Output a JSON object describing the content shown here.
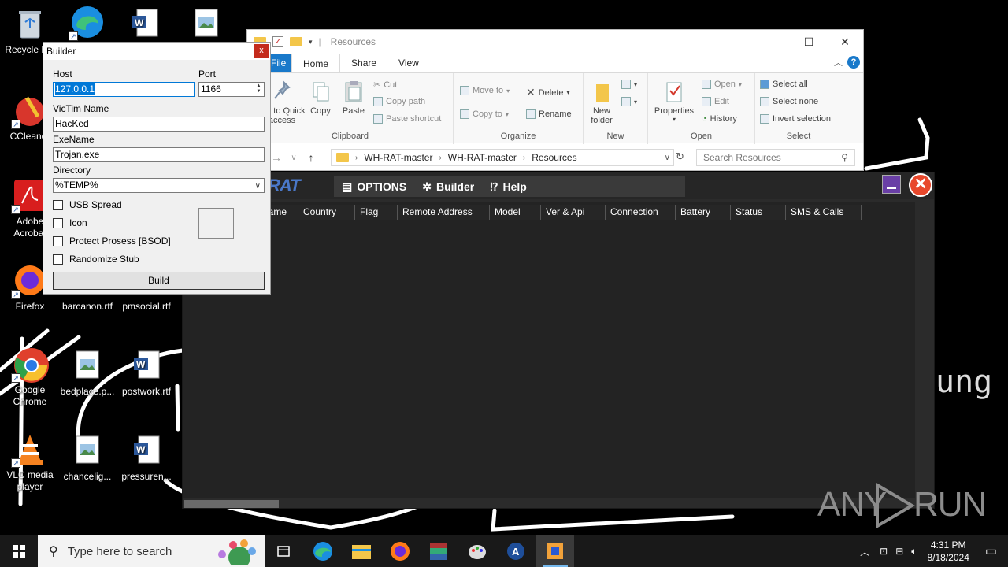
{
  "desktop": {
    "icons": [
      {
        "label": "Recycle Bin",
        "icon": "recycle-bin-icon"
      },
      {
        "label": "",
        "icon": "edge-icon"
      },
      {
        "label": "",
        "icon": "word-doc-icon"
      },
      {
        "label": "",
        "icon": "image-file-icon"
      },
      {
        "label": "CCleaner",
        "icon": "ccleaner-icon"
      },
      {
        "label": "Adobe Acrobat",
        "icon": "acrobat-icon"
      },
      {
        "label": "Firefox",
        "icon": "firefox-icon"
      },
      {
        "label": "barcanon.rtf",
        "icon": "word-doc-icon"
      },
      {
        "label": "pmsocial.rtf",
        "icon": "word-doc-icon"
      },
      {
        "label": "Google Chrome",
        "icon": "chrome-icon"
      },
      {
        "label": "bedplace.p...",
        "icon": "image-file-icon"
      },
      {
        "label": "postwork.rtf",
        "icon": "word-doc-icon"
      },
      {
        "label": "VLC media player",
        "icon": "vlc-icon"
      },
      {
        "label": "chancelig...",
        "icon": "image-file-icon"
      },
      {
        "label": "pressuren...",
        "icon": "word-doc-icon"
      }
    ],
    "background_word": "ung"
  },
  "explorer": {
    "title": "Resources",
    "tabs": {
      "file": "File",
      "home": "Home",
      "share": "Share",
      "view": "View"
    },
    "ribbon": {
      "clipboard": {
        "pin": "Pin to Quick access",
        "copy": "Copy",
        "paste": "Paste",
        "cut": "Cut",
        "copy_path": "Copy path",
        "paste_shortcut": "Paste shortcut",
        "label": "Clipboard"
      },
      "organize": {
        "move_to": "Move to",
        "copy_to": "Copy to",
        "delete": "Delete",
        "rename": "Rename",
        "label": "Organize"
      },
      "new": {
        "new_folder": "New folder",
        "label": "New"
      },
      "open": {
        "properties": "Properties",
        "open": "Open",
        "edit": "Edit",
        "history": "History",
        "label": "Open"
      },
      "select": {
        "select_all": "Select all",
        "select_none": "Select none",
        "invert": "Invert selection",
        "label": "Select"
      }
    },
    "address": [
      "WH-RAT-master",
      "WH-RAT-master",
      "Resources"
    ],
    "search_placeholder": "Search Resources"
  },
  "rat": {
    "logo": "RAT",
    "menu": {
      "options": "OPTIONS",
      "builder": "Builder",
      "help": "Help"
    },
    "columns": [
      "Name",
      "Country",
      "Flag",
      "Remote Address",
      "Model",
      "Ver & Api",
      "Connection",
      "Battery",
      "Status",
      "SMS & Calls"
    ]
  },
  "builder": {
    "title": "Builder",
    "host_label": "Host",
    "host_value": "127.0.0.1",
    "port_label": "Port",
    "port_value": "1166",
    "victim_label": "VicTim Name",
    "victim_value": "HacKed",
    "exe_label": "ExeName",
    "exe_value": "Trojan.exe",
    "dir_label": "Directory",
    "dir_value": "%TEMP%",
    "options": [
      "USB Spread",
      "Icon",
      "Protect Prosess [BSOD]",
      "Randomize Stub"
    ],
    "build_label": "Build"
  },
  "watermark": {
    "left": "ANY",
    "right": "RUN"
  },
  "taskbar": {
    "search_placeholder": "Type here to search",
    "time": "4:31 PM",
    "date": "8/18/2024"
  },
  "colors": {
    "accent": "#1979ca",
    "rat_bg": "#2b2b2b",
    "close_red": "#e8482c"
  }
}
